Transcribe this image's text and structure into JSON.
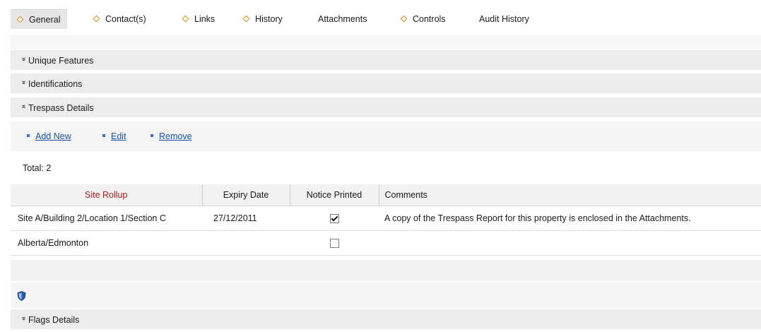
{
  "tabs": [
    {
      "label": "General",
      "marker": true,
      "active": true
    },
    {
      "label": "Contact(s)",
      "marker": true
    },
    {
      "label": "Links",
      "marker": true
    },
    {
      "label": "History",
      "marker": true
    },
    {
      "label": "Attachments",
      "marker": false
    },
    {
      "label": "Controls",
      "marker": true
    },
    {
      "label": "Audit History",
      "marker": false
    }
  ],
  "sections": {
    "unique_features": "Unique Features",
    "identifications": "Identifications",
    "trespass_details": "Trespass Details",
    "flags_details": "Flags Details"
  },
  "actions": {
    "add_new": "Add New",
    "edit": "Edit",
    "remove": "Remove"
  },
  "total_label": "Total: 2",
  "grid": {
    "columns": [
      "Site Rollup",
      "Expiry Date",
      "Notice Printed",
      "Comments"
    ],
    "rows": [
      {
        "site": "Site A/Building 2/Location 1/Section C",
        "expiry": "27/12/2011",
        "notice_printed": true,
        "comments": "A copy of the Trespass Report for this property is enclosed in the Attachments."
      },
      {
        "site": "Alberta/Edmonton",
        "expiry": "",
        "notice_printed": false,
        "comments": ""
      }
    ]
  },
  "icons": {
    "tab_marker": "diamond-icon",
    "collapsed": "chevron-double-down-icon",
    "expanded": "chevron-double-up-icon",
    "status": "shield-icon"
  },
  "colors": {
    "tab_marker": "#e08a1c",
    "link": "#1b4fa8",
    "sort_header": "#a22020"
  }
}
